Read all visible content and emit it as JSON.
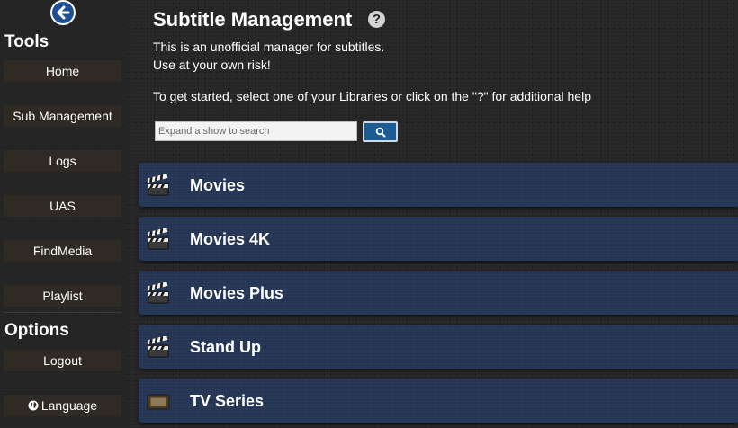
{
  "sidebar": {
    "tools_heading": "Tools",
    "tools": [
      {
        "label": "Home"
      },
      {
        "label": "Sub Management"
      },
      {
        "label": "Logs"
      },
      {
        "label": "UAS"
      },
      {
        "label": "FindMedia"
      },
      {
        "label": "Playlist"
      }
    ],
    "options_heading": "Options",
    "logout_label": "Logout",
    "language_label": "Language"
  },
  "main": {
    "title": "Subtitle Management",
    "help_symbol": "?",
    "intro_line1": "This is an unofficial manager for subtitles.",
    "intro_line2": "Use at your own risk!",
    "instructions": "To get started, select one of your Libraries or click on the \"?\" for additional help",
    "search_placeholder": "Expand a show to search",
    "libraries": [
      {
        "name": "Movies",
        "icon": "clapperboard-icon"
      },
      {
        "name": "Movies 4K",
        "icon": "clapperboard-icon"
      },
      {
        "name": "Movies Plus",
        "icon": "clapperboard-icon"
      },
      {
        "name": "Stand Up",
        "icon": "clapperboard-icon"
      },
      {
        "name": "TV Series",
        "icon": "tv-icon"
      }
    ]
  },
  "colors": {
    "accent_blue": "#1e4f96",
    "library_bar": "#243554",
    "nav_button": "#2f2a24"
  }
}
